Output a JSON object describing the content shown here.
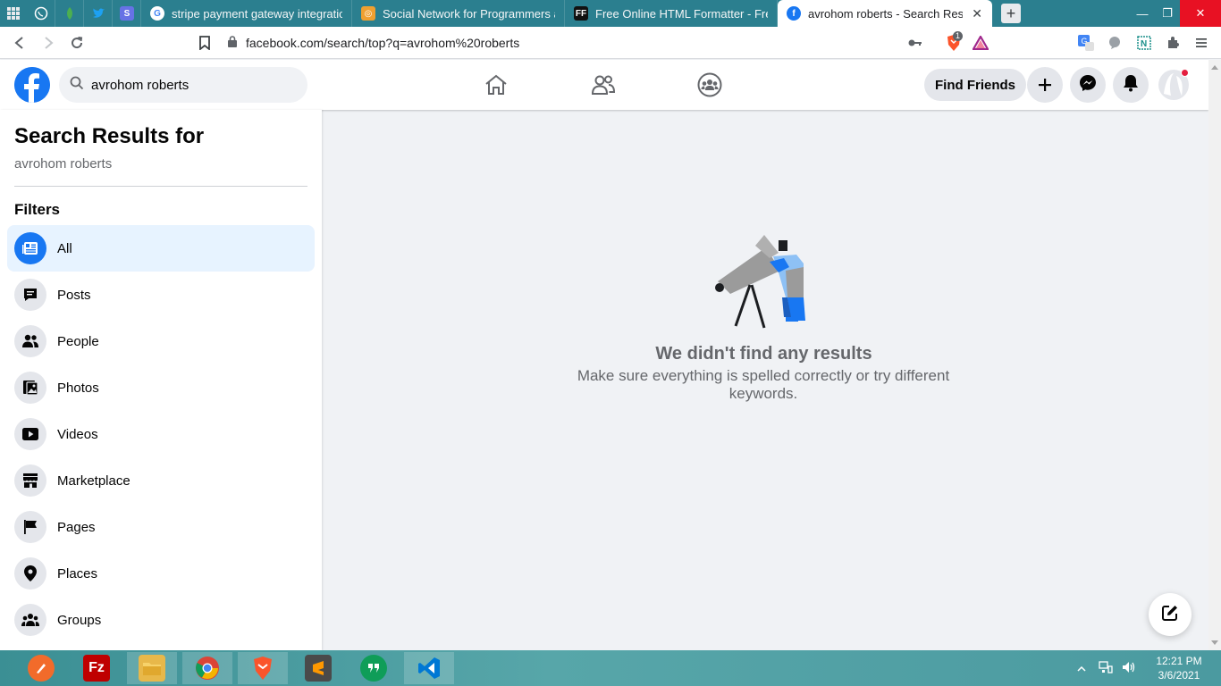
{
  "browser": {
    "tabs": [
      {
        "title": "",
        "icon": "whatsapp-icon",
        "color": "#3ddc84"
      },
      {
        "title": "",
        "icon": "mongodb-leaf-icon",
        "color": "#4caf50"
      },
      {
        "title": "",
        "icon": "twitter-icon",
        "color": "#1da1f2"
      },
      {
        "title": "",
        "icon": "stripe-icon",
        "color": "#6772e5"
      },
      {
        "title": "stripe payment gateway integration in",
        "icon": "google-icon",
        "color": "#ffffff"
      },
      {
        "title": "Social Network for Programmers and D",
        "icon": "devconnector-icon",
        "color": "#f0a030"
      },
      {
        "title": "Free Online HTML Formatter - FreeFor",
        "icon": "freeformatter-icon",
        "color": "#111111"
      },
      {
        "title": "avrohom roberts - Search Results",
        "icon": "facebook-icon",
        "color": "#1877f2",
        "active": true
      }
    ],
    "url": "facebook.com/search/top?q=avrohom%20roberts",
    "brave_badge": "1"
  },
  "fb": {
    "search_value": "avrohom roberts",
    "find_friends_label": "Find Friends"
  },
  "sidebar": {
    "title": "Search Results for",
    "query": "avrohom roberts",
    "filters_label": "Filters",
    "filters": [
      {
        "label": "All",
        "icon": "all-results-icon",
        "active": true
      },
      {
        "label": "Posts",
        "icon": "posts-icon"
      },
      {
        "label": "People",
        "icon": "people-icon"
      },
      {
        "label": "Photos",
        "icon": "photos-icon"
      },
      {
        "label": "Videos",
        "icon": "videos-icon"
      },
      {
        "label": "Marketplace",
        "icon": "marketplace-icon"
      },
      {
        "label": "Pages",
        "icon": "pages-flag-icon"
      },
      {
        "label": "Places",
        "icon": "places-pin-icon"
      },
      {
        "label": "Groups",
        "icon": "groups-icon"
      }
    ]
  },
  "main": {
    "no_results_title": "We didn't find any results",
    "no_results_desc": "Make sure everything is spelled correctly or try different keywords."
  },
  "taskbar": {
    "apps": [
      "pen-app-icon",
      "filezilla-icon",
      "file-explorer-icon",
      "chrome-icon",
      "brave-icon",
      "sublime-text-icon",
      "hangouts-icon",
      "vscode-icon"
    ],
    "time": "12:21 PM",
    "date": "3/6/2021"
  },
  "colors": {
    "fb_blue": "#1877f2",
    "active_filter_bg": "#e7f3ff",
    "tabstrip": "#2b7f8f",
    "notification_red": "#e41e3f"
  }
}
